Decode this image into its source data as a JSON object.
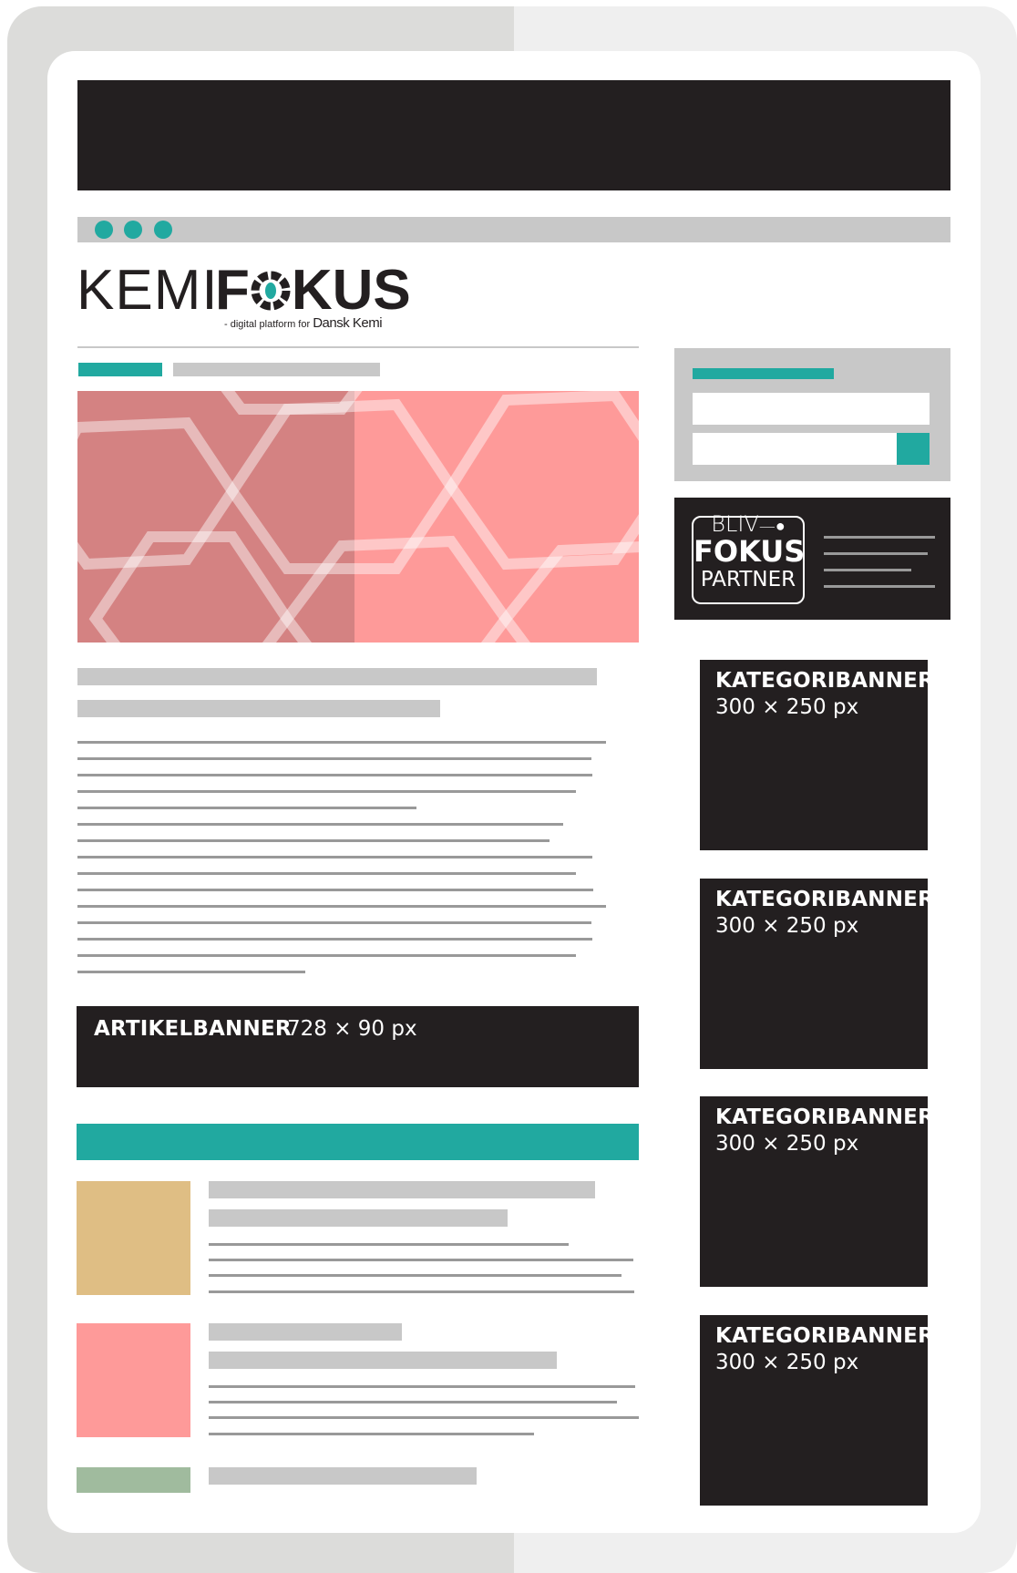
{
  "logo": {
    "part1": "KEMI",
    "part2_a": "F",
    "part2_b": "KUS",
    "tagline_prefix": "- digital platform for",
    "tagline_brand": "Dansk Kemi"
  },
  "partner_badge": {
    "line1": "BLIV",
    "line2": "FOKUS",
    "line3": "PARTNER"
  },
  "article_banner": {
    "title": "ARTIKELBANNER",
    "size": "728 × 90 px"
  },
  "category_banners": [
    {
      "title": "KATEGORIBANNER",
      "size": "300 × 250 px"
    },
    {
      "title": "KATEGORIBANNER",
      "size": "300 × 250 px"
    },
    {
      "title": "KATEGORIBANNER",
      "size": "300 × 250 px"
    },
    {
      "title": "KATEGORIBANNER",
      "size": "300 × 250 px"
    }
  ],
  "colors": {
    "accent": "#21a9a0",
    "dark": "#231f20",
    "placeholder_grey": "#c8c8c8",
    "hero_dark_pink": "#d48282",
    "hero_light_pink": "#fe9a99",
    "thumb_tan": "#dfbe84",
    "thumb_pink": "#fe9a99",
    "thumb_green": "#a0bb9e"
  }
}
